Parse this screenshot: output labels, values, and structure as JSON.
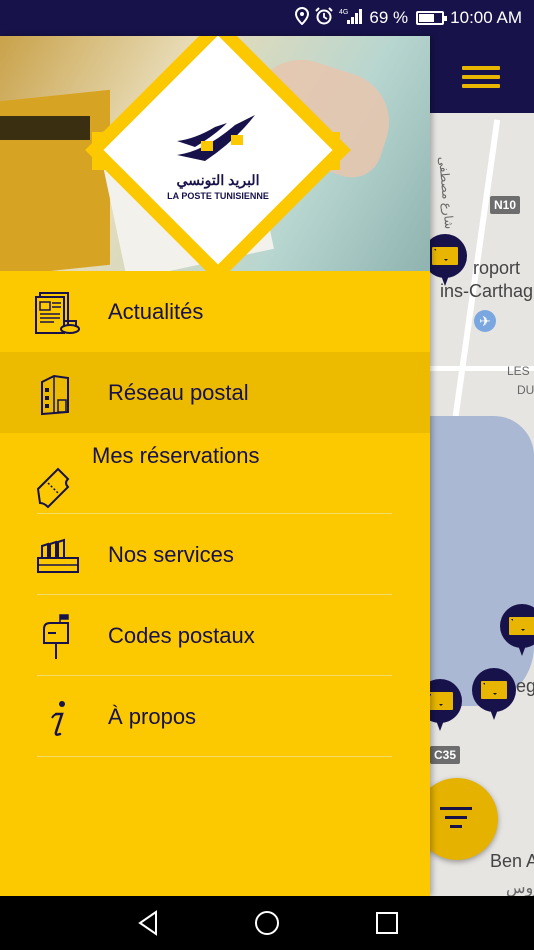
{
  "status_bar": {
    "battery_percent": "69 %",
    "time": "10:00 AM",
    "battery_level": 0.69,
    "icons": [
      "location-icon",
      "alarm-icon",
      "signal-icon",
      "battery-icon"
    ]
  },
  "logo": {
    "arabic_text": "البريد التونسي",
    "latin_text": "LA POSTE TUNISIENNE"
  },
  "menu": {
    "items": [
      {
        "label": "Actualités",
        "icon": "newspaper-icon",
        "selected": false
      },
      {
        "label": "Réseau postal",
        "icon": "building-icon",
        "selected": true
      },
      {
        "label": "Mes réservations",
        "icon": "ticket-icon",
        "selected": false
      },
      {
        "label": "Nos services",
        "icon": "mail-tray-icon",
        "selected": false
      },
      {
        "label": "Codes postaux",
        "icon": "mailbox-icon",
        "selected": false
      },
      {
        "label": "À propos",
        "icon": "info-icon",
        "selected": false
      }
    ]
  },
  "map": {
    "road_badge_top": "N10",
    "road_badge_bottom": "C35",
    "label_airport_1": "roport",
    "label_airport_2": "ins-Carthag",
    "label_les": "LES",
    "label_du": "DU",
    "label_ben": "Ben A",
    "label_arabic_top": "شارع مصطفى",
    "label_arabic_bottom": "ـروس",
    "label_reg": "eg"
  },
  "colors": {
    "navy": "#17124a",
    "yellow": "#fcc800",
    "selected_yellow": "#ecbb00",
    "accent_gold": "#e8b600"
  }
}
